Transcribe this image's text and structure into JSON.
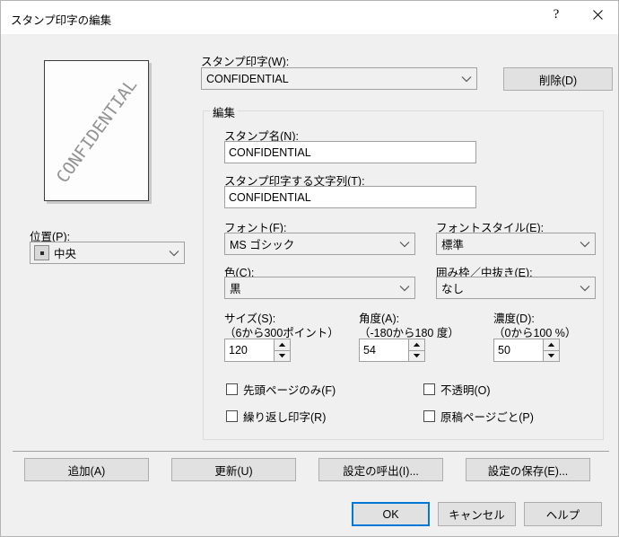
{
  "window": {
    "title": "スタンプ印字の編集",
    "help_button": "?",
    "close_button": "✕"
  },
  "preview": {
    "stamp_text": "CONFIDENTIAL",
    "rotation_deg": 54,
    "color": "#8a8a8a"
  },
  "position": {
    "label": "位置(P):",
    "label_plain": "位置",
    "accel": "P",
    "value": "中央",
    "icon": "position-center-icon"
  },
  "stamp_select": {
    "label": "スタンプ印字(W):",
    "value": "CONFIDENTIAL"
  },
  "delete_button": {
    "label": "削除(D)"
  },
  "edit_group": {
    "title": "編集",
    "stamp_name": {
      "label": "スタンプ名(N):",
      "value": "CONFIDENTIAL"
    },
    "stamp_string": {
      "label": "スタンプ印字する文字列(T):",
      "value": "CONFIDENTIAL"
    },
    "font": {
      "label": "フォント(F):",
      "value": "MS ゴシック"
    },
    "font_style": {
      "label": "フォントスタイル(E):",
      "value": "標準"
    },
    "color": {
      "label": "色(C):",
      "value": "黒"
    },
    "outline": {
      "label": "囲み枠／中抜き(E):",
      "value": "なし"
    },
    "size": {
      "label": "サイズ(S):",
      "range": "（6から300ポイント）",
      "value": "120"
    },
    "angle": {
      "label": "角度(A):",
      "range": "（-180から180 度）",
      "value": "54"
    },
    "density": {
      "label": "濃度(D):",
      "range": "（0から100 %）",
      "value": "50"
    },
    "checkboxes": [
      {
        "label": "先頭ページのみ(F)",
        "checked": false
      },
      {
        "label": "不透明(O)",
        "checked": false
      },
      {
        "label": "繰り返し印字(R)",
        "checked": false
      },
      {
        "label": "原稿ページごと(P)",
        "checked": false
      }
    ]
  },
  "action_buttons": {
    "add": "追加(A)",
    "update": "更新(U)",
    "load_settings": "設定の呼出(I)...",
    "save_settings": "設定の保存(E)..."
  },
  "dialog_buttons": {
    "ok": "OK",
    "cancel": "キャンセル",
    "help": "ヘルプ"
  },
  "colors": {
    "dialog_bg": "#f0f0f0",
    "titlebar_bg": "#ffffff",
    "input_bg": "#ffffff",
    "button_bg": "#e1e1e1",
    "focus_border": "#0078d7",
    "border": "#a0a0a0"
  }
}
